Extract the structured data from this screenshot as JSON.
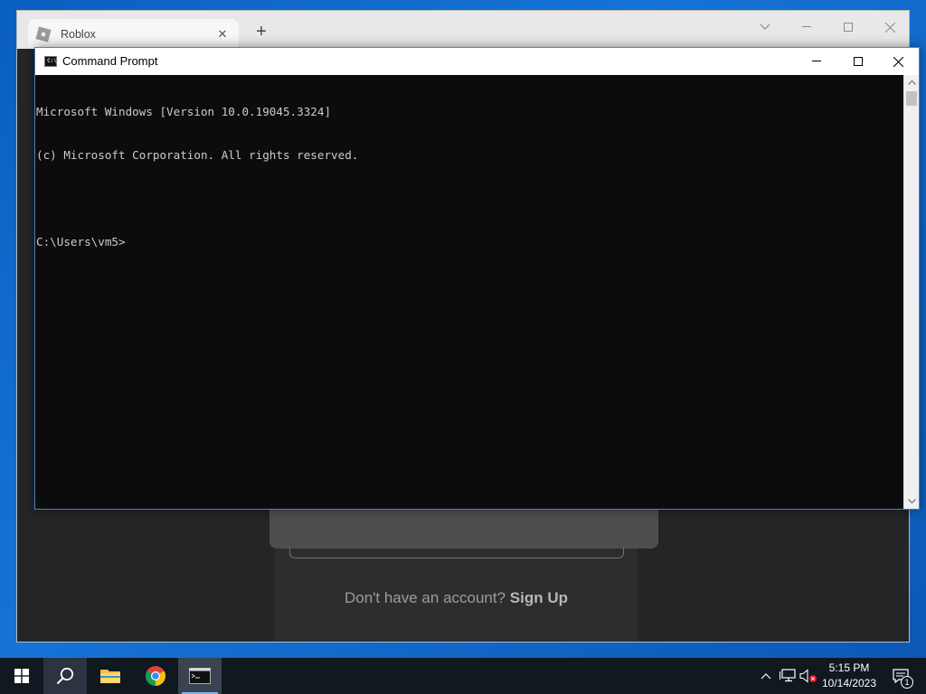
{
  "browser": {
    "tab_title": "Roblox",
    "tab_close": "✕",
    "new_tab": "+",
    "signup_prompt": "Don't have an account?",
    "signup_link": "Sign Up"
  },
  "cmd": {
    "title": "Command Prompt",
    "lines": [
      "Microsoft Windows [Version 10.0.19045.3324]",
      "(c) Microsoft Corporation. All rights reserved.",
      "",
      "C:\\Users\\vm5>"
    ]
  },
  "taskbar": {
    "apps": [
      "start",
      "search",
      "file-explorer",
      "chrome",
      "command-prompt"
    ],
    "clock_time": "5:15 PM",
    "clock_date": "10/14/2023",
    "notification_count": "1"
  },
  "colors": {
    "desktop": "#0b63c6",
    "cmd_background": "#0c0c0c",
    "cmd_text": "#cccccc",
    "taskbar": "#101820",
    "roblox_background": "#232527"
  }
}
